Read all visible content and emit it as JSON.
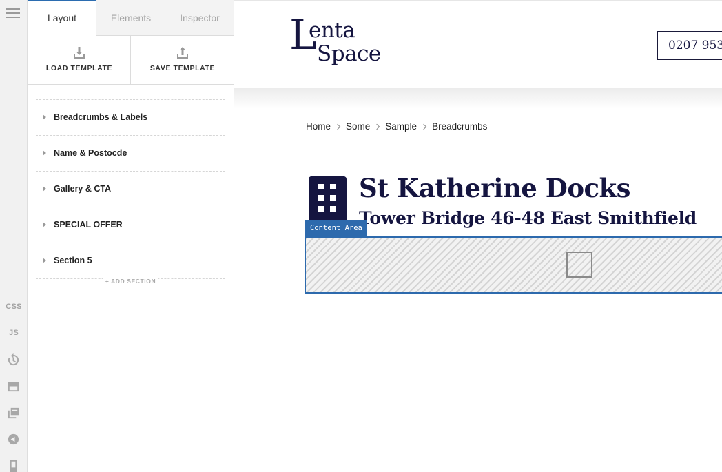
{
  "rail": {
    "css_label": "CSS",
    "js_label": "JS",
    "icons": [
      "menu-icon",
      "history-icon",
      "window-icon",
      "layers-icon",
      "back-icon",
      "mobile-icon"
    ]
  },
  "panel": {
    "tabs": [
      {
        "label": "Layout",
        "active": true
      },
      {
        "label": "Elements",
        "active": false
      },
      {
        "label": "Inspector",
        "active": false
      }
    ],
    "load_template": "LOAD TEMPLATE",
    "save_template": "SAVE TEMPLATE",
    "sections": [
      {
        "label": "Breadcrumbs & Labels"
      },
      {
        "label": "Name & Postocde"
      },
      {
        "label": "Gallery & CTA"
      },
      {
        "label": "SPECIAL OFFER"
      },
      {
        "label": "Section 5"
      }
    ],
    "add_section": "+ ADD SECTION"
  },
  "canvas": {
    "logo": {
      "initial": "L",
      "word1": "enta",
      "word2": "Space"
    },
    "phone": "0207 953",
    "breadcrumbs": [
      "Home",
      "Some",
      "Sample",
      "Breadcrumbs"
    ],
    "title": "St Katherine Docks",
    "subtitle": "Tower Bridge 46-48 East Smithfield",
    "content_area_label": "Content Area"
  },
  "colors": {
    "accent": "#2d6aad",
    "brand_navy": "#151540"
  }
}
